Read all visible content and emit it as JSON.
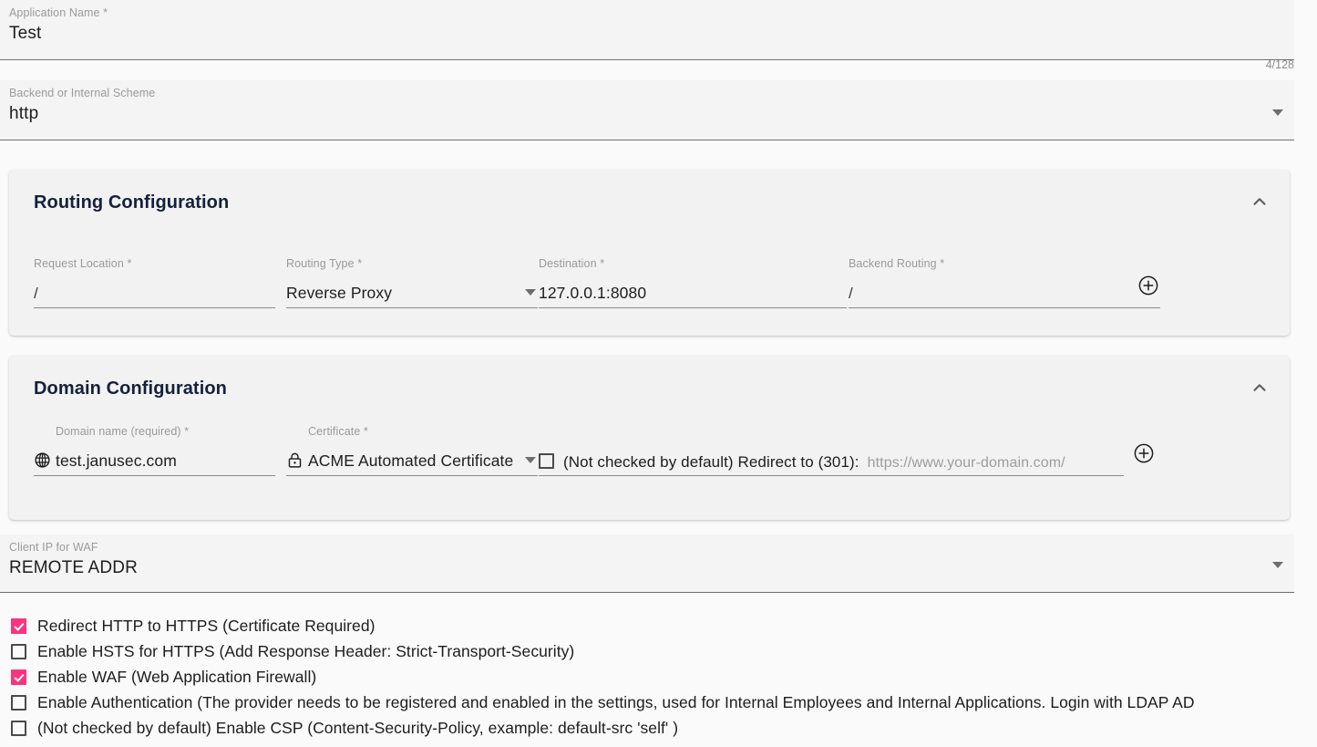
{
  "application_name": {
    "label": "Application Name *",
    "value": "Test",
    "counter": "4/128"
  },
  "backend_scheme": {
    "label": "Backend or Internal Scheme",
    "value": "http",
    "dropdown_icon": "chevron-down-icon"
  },
  "routing_card": {
    "title": "Routing Configuration",
    "collapse_icon": "chevron-up-icon",
    "request_location": {
      "label": "Request Location *",
      "value": "/"
    },
    "routing_type": {
      "label": "Routing Type *",
      "value": "Reverse Proxy",
      "dropdown_icon": "chevron-down-icon"
    },
    "destination": {
      "label": "Destination *",
      "value": "127.0.0.1:8080"
    },
    "backend_routing": {
      "label": "Backend Routing *",
      "value": "/"
    },
    "add_button": {
      "icon": "plus-circle-icon",
      "title": "Add routing rule"
    }
  },
  "domain_card": {
    "title": "Domain Configuration",
    "collapse_icon": "chevron-up-icon",
    "domain_name": {
      "label": "Domain name (required) *",
      "value": "test.janusec.com",
      "icon": "globe-icon"
    },
    "certificate": {
      "label": "Certificate *",
      "value": "ACME Automated Certificate",
      "icon": "lock-icon",
      "dropdown_icon": "chevron-down-icon"
    },
    "redirect": {
      "checked": false,
      "label": "(Not checked by default) Redirect to (301):",
      "placeholder": "https://www.your-domain.com/",
      "value": ""
    },
    "add_button": {
      "icon": "plus-circle-icon",
      "title": "Add domain"
    }
  },
  "client_ip_waf": {
    "label": "Client IP for WAF",
    "value": "REMOTE ADDR",
    "dropdown_icon": "chevron-down-icon"
  },
  "options": [
    {
      "checked": true,
      "label": "Redirect HTTP to HTTPS (Certificate Required)"
    },
    {
      "checked": false,
      "label": "Enable HSTS for HTTPS (Add Response Header: Strict-Transport-Security)"
    },
    {
      "checked": true,
      "label": "Enable WAF (Web Application Firewall)"
    },
    {
      "checked": false,
      "label": "Enable Authentication (The provider needs to be registered and enabled in the settings, used for Internal Employees and Internal Applications. Login with LDAP AD"
    },
    {
      "checked": false,
      "label": "(Not checked by default) Enable CSP (Content-Security-Policy, example: default-src 'self' )"
    }
  ],
  "colors": {
    "accent": "#f8357e",
    "page_background": "#fafafa",
    "field_background": "#f4f4f4",
    "card_background": "#f2f2f2",
    "label_text": "#9a9a9a",
    "value_text": "#1d1d1d",
    "title_text": "#15213b"
  }
}
